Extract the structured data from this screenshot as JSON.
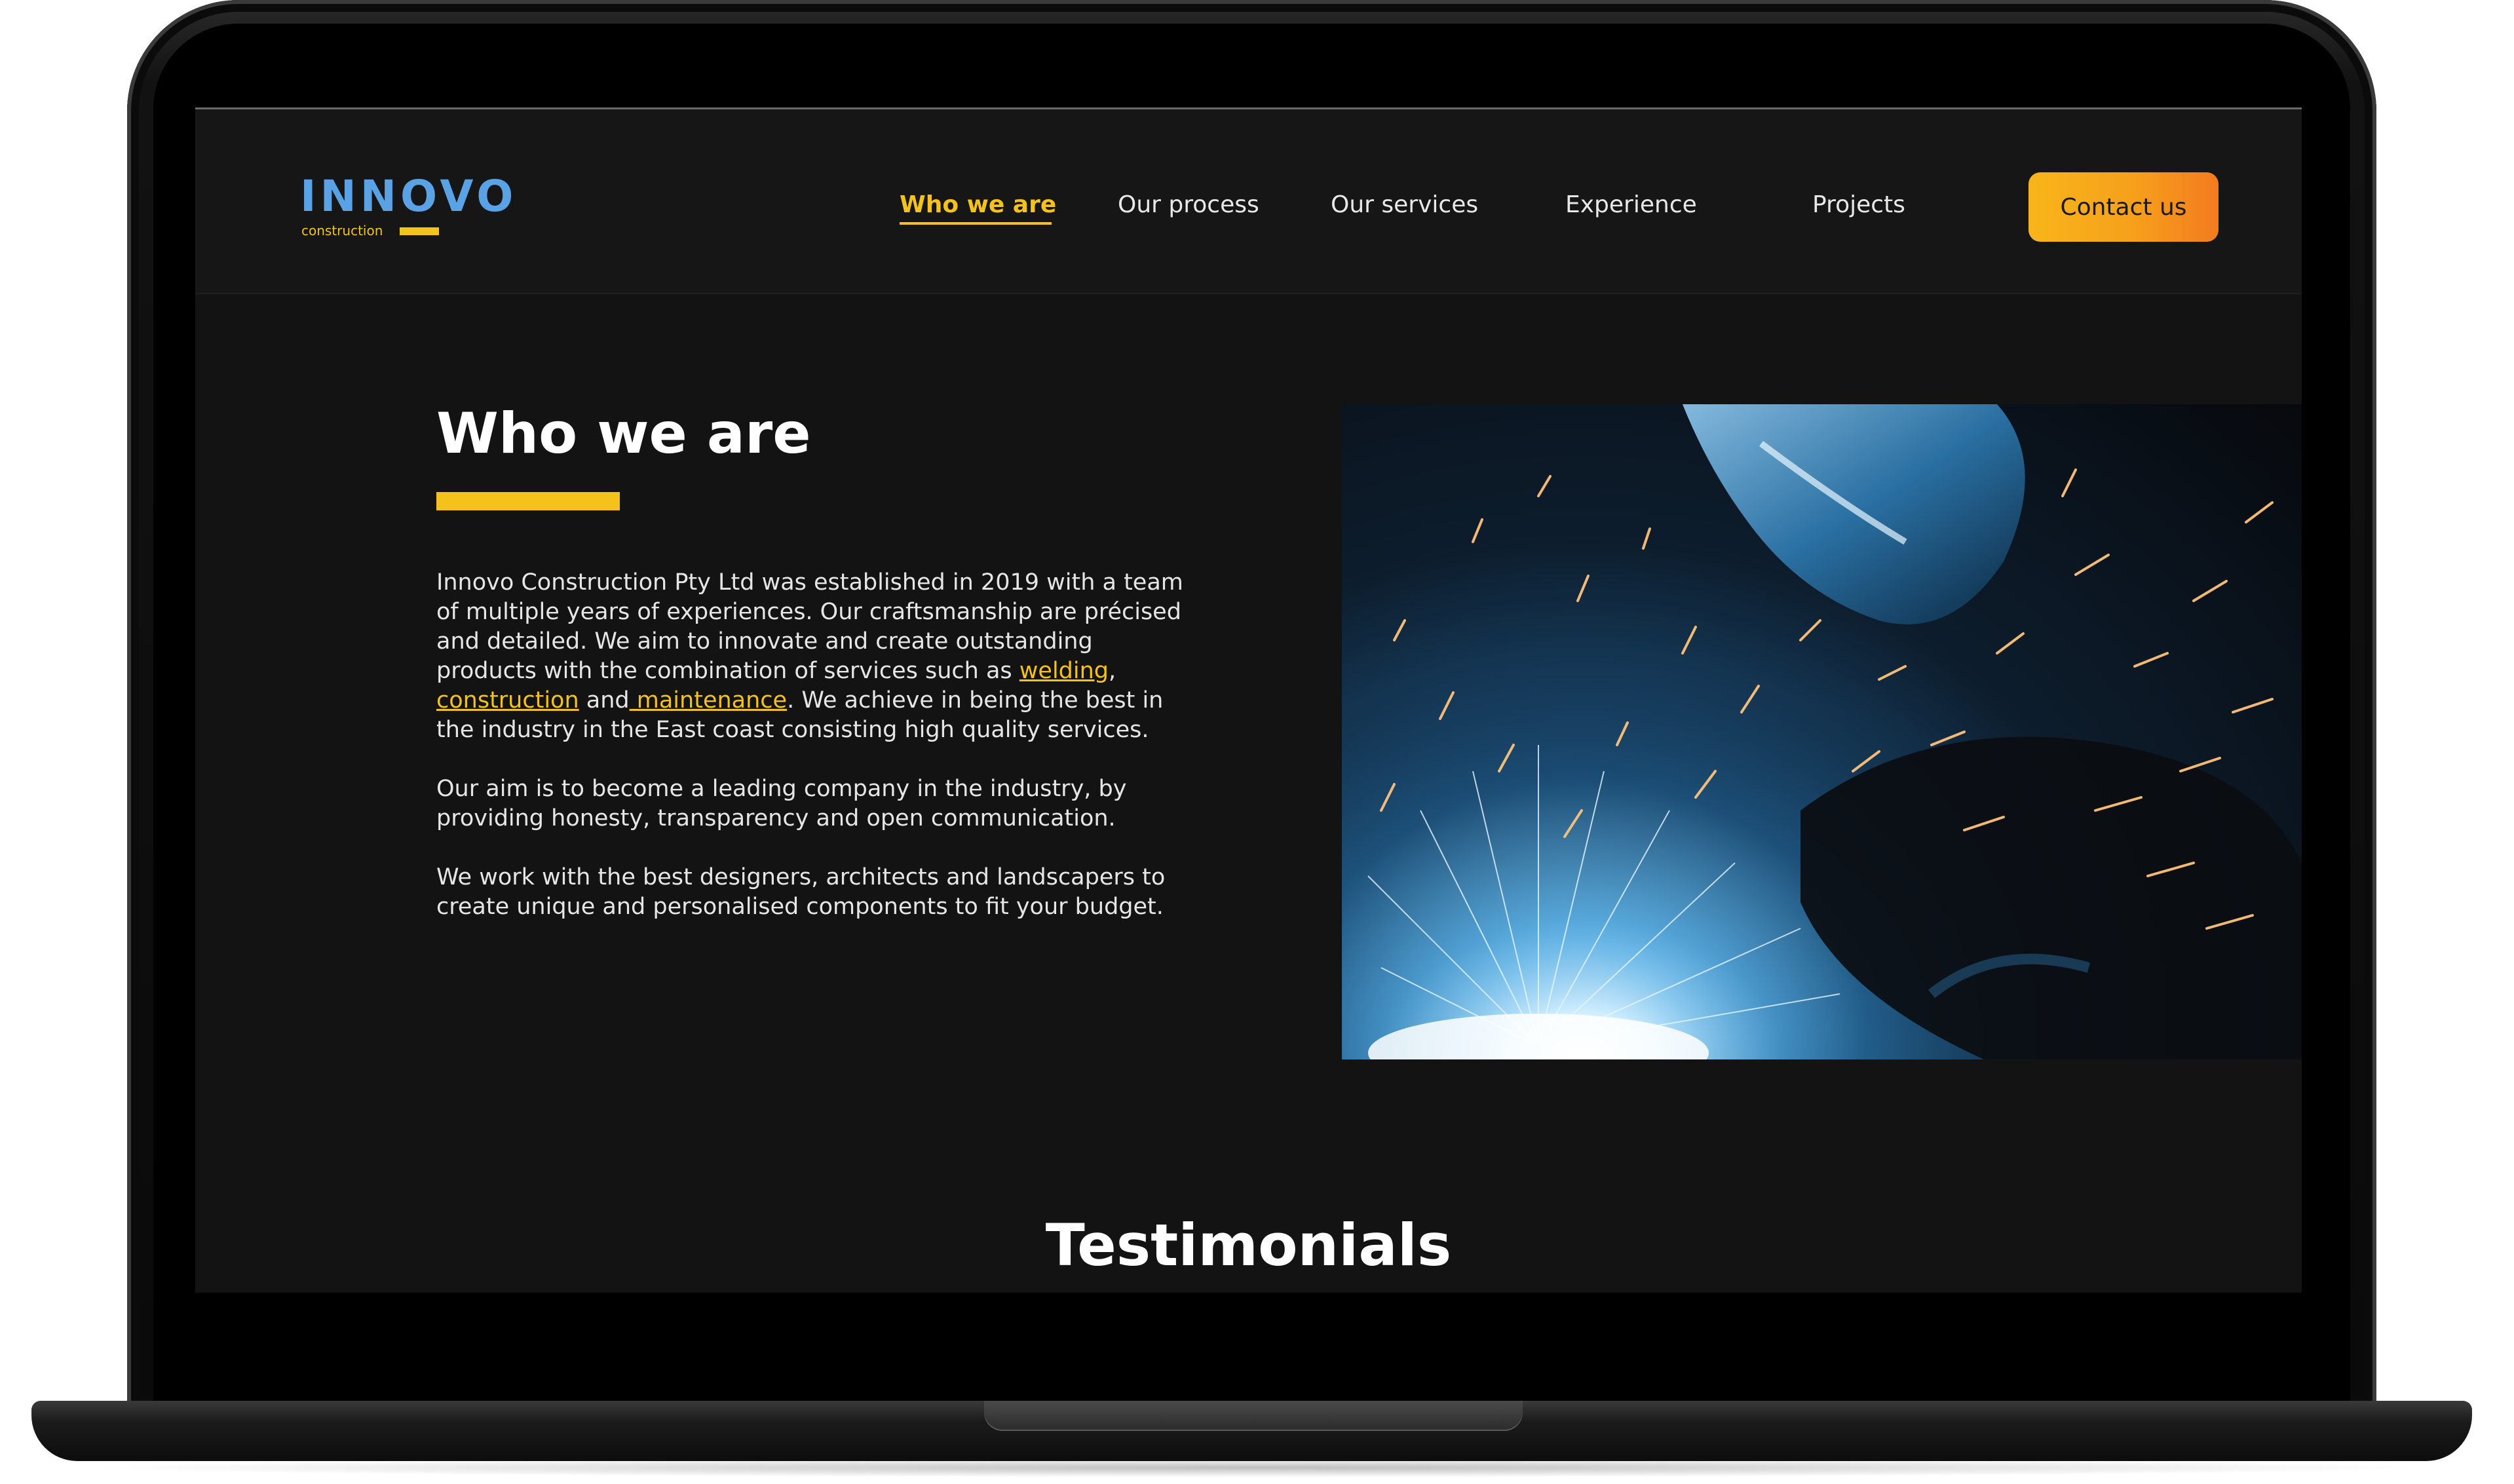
{
  "nav": {
    "logo": {
      "word": "INNOVO",
      "sub": "construction"
    },
    "items": [
      {
        "label": "Who we are",
        "active": true
      },
      {
        "label": "Our process",
        "active": false
      },
      {
        "label": "Our services",
        "active": false
      },
      {
        "label": "Experience",
        "active": false
      },
      {
        "label": "Projects",
        "active": false
      }
    ],
    "cta": "Contact us"
  },
  "about": {
    "title": "Who we are",
    "p1_before": "Innovo Construction Pty Ltd was established in 2019 with a team of multiple years of experiences. Our craftsmanship are précised and detailed. We aim to innovate and create outstanding products with the combination of services such as ",
    "link_welding": "welding",
    "sep_comma": ", ",
    "link_construction": "construction",
    "sep_and": " and",
    "link_maintenance": " maintenance",
    "p1_after": ". We achieve in being the best in the industry in the East coast consisting high quality services.",
    "p2": "Our aim is to become a leading company in the industry, by providing honesty, transparency and open communication.",
    "p3": "We work with the best designers, architects and landscapers to create unique and personalised components to fit your budget."
  },
  "photo": {
    "icon": "welding-sparks-photo"
  },
  "testimonials": {
    "title": "Testimonials"
  },
  "colors": {
    "accent": "#f5c21b",
    "cta_gradient_start": "#f8b51a",
    "cta_gradient_end": "#f37b1f",
    "logo_blue": "#5aa2e6",
    "background": "#131313"
  }
}
